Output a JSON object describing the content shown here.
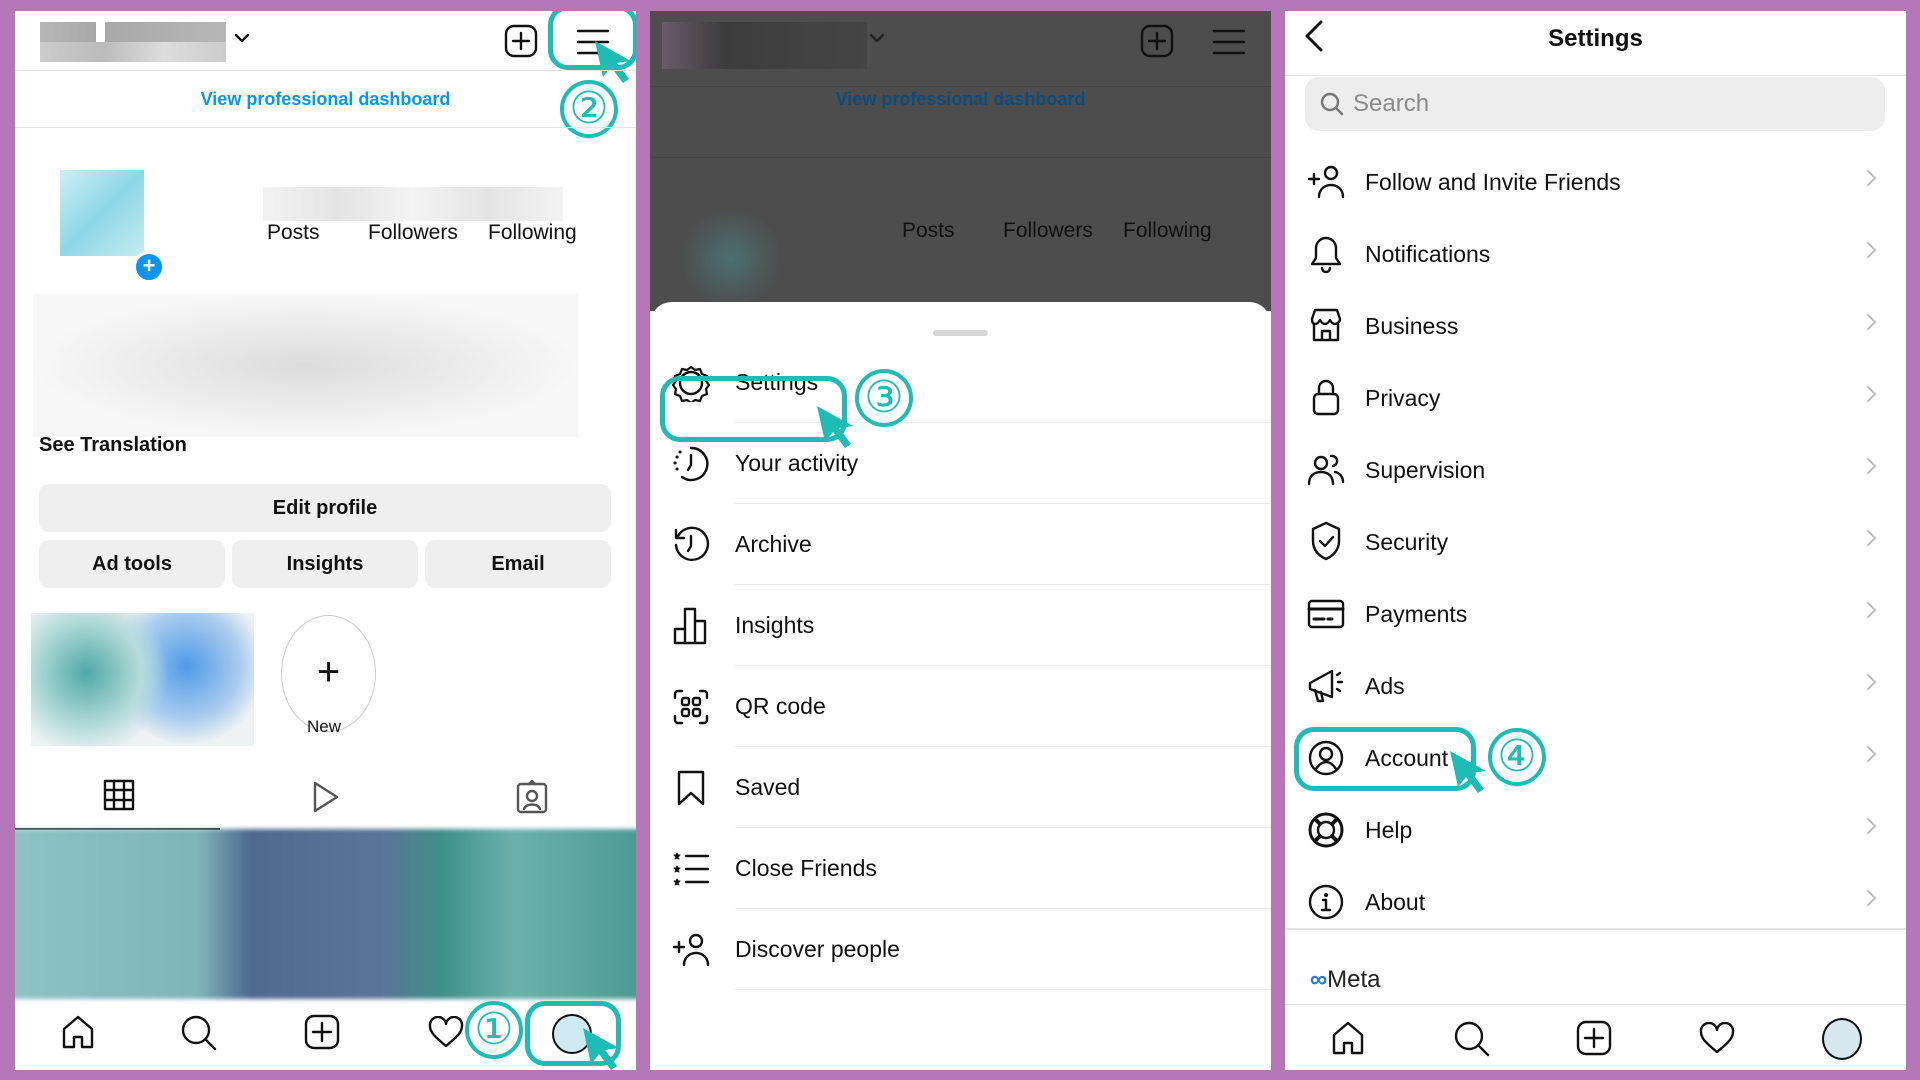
{
  "annotation_color": "#1dbcb4",
  "background_color": "#b577b8",
  "profile_screen": {
    "professional_dashboard_link": "View professional dashboard",
    "stats": [
      {
        "label": "Posts"
      },
      {
        "label": "Followers"
      },
      {
        "label": "Following"
      }
    ],
    "see_translation": "See Translation",
    "edit_profile": "Edit profile",
    "buttons": [
      "Ad tools",
      "Insights",
      "Email"
    ],
    "new_highlight": "New",
    "step_markers": {
      "menu": "②",
      "profile": "①"
    }
  },
  "menu_screen": {
    "professional_dashboard_link": "View professional dashboard",
    "stats": [
      {
        "label": "Posts"
      },
      {
        "label": "Followers"
      },
      {
        "label": "Following"
      }
    ],
    "items": [
      {
        "label": "Settings",
        "icon": "settings-icon"
      },
      {
        "label": "Your activity",
        "icon": "activity-icon"
      },
      {
        "label": "Archive",
        "icon": "archive-icon"
      },
      {
        "label": "Insights",
        "icon": "insights-icon"
      },
      {
        "label": "QR code",
        "icon": "qr-code-icon"
      },
      {
        "label": "Saved",
        "icon": "bookmark-icon"
      },
      {
        "label": "Close Friends",
        "icon": "close-friends-icon"
      },
      {
        "label": "Discover people",
        "icon": "add-person-icon"
      }
    ],
    "step_marker": "③"
  },
  "settings_screen": {
    "title": "Settings",
    "search_placeholder": "Search",
    "items": [
      {
        "label": "Follow and Invite Friends",
        "icon": "add-person-icon"
      },
      {
        "label": "Notifications",
        "icon": "bell-icon"
      },
      {
        "label": "Business",
        "icon": "store-icon"
      },
      {
        "label": "Privacy",
        "icon": "lock-icon"
      },
      {
        "label": "Supervision",
        "icon": "supervision-icon"
      },
      {
        "label": "Security",
        "icon": "shield-icon"
      },
      {
        "label": "Payments",
        "icon": "card-icon"
      },
      {
        "label": "Ads",
        "icon": "megaphone-icon"
      },
      {
        "label": "Account",
        "icon": "account-icon"
      },
      {
        "label": "Help",
        "icon": "lifebuoy-icon"
      },
      {
        "label": "About",
        "icon": "info-icon"
      }
    ],
    "meta_label": "Meta",
    "step_marker": "④"
  }
}
